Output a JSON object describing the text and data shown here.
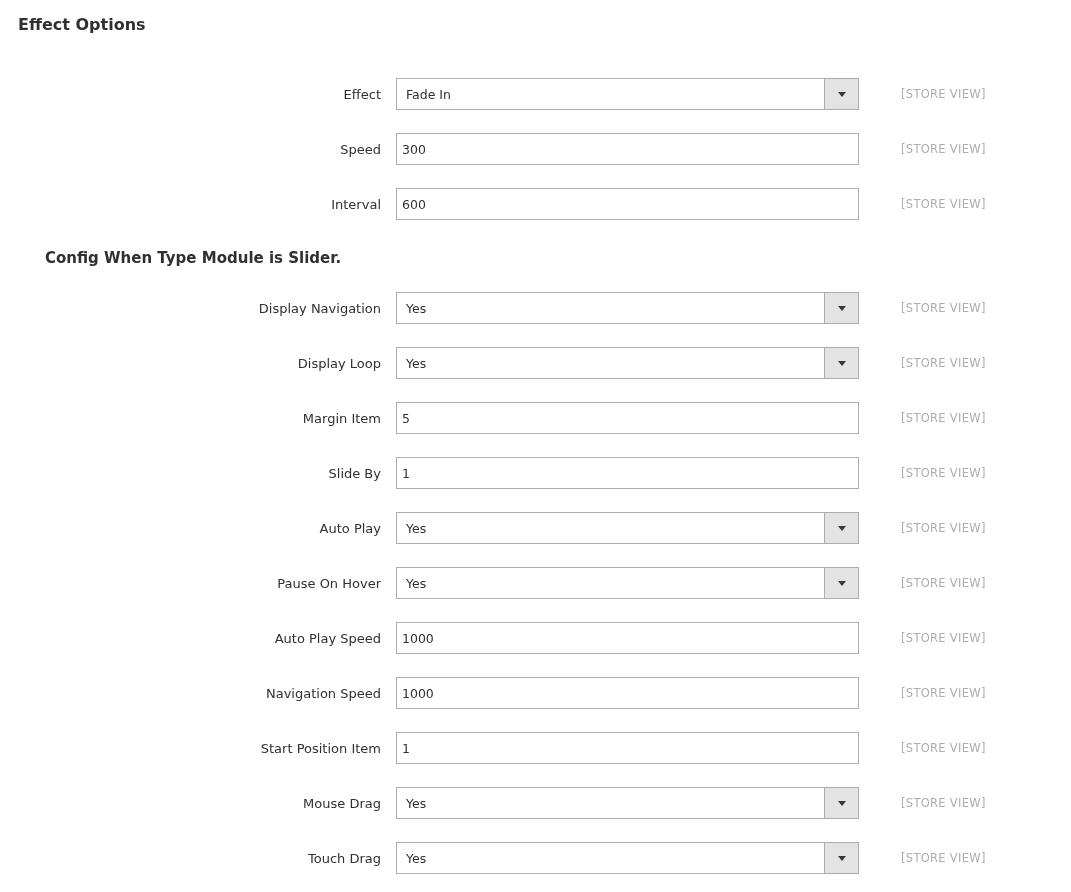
{
  "title": "Effect Options",
  "groups": [
    {
      "fields": [
        {
          "kind": "select",
          "label": "Effect",
          "value": "Fade In",
          "scope": "[STORE VIEW]"
        },
        {
          "kind": "text",
          "label": "Speed",
          "value": "300",
          "scope": "[STORE VIEW]"
        },
        {
          "kind": "text",
          "label": "Interval",
          "value": "600",
          "scope": "[STORE VIEW]"
        }
      ]
    },
    {
      "heading": "Config When Type Module is Slider.",
      "fields": [
        {
          "kind": "select",
          "label": "Display Navigation",
          "value": "Yes",
          "scope": "[STORE VIEW]"
        },
        {
          "kind": "select",
          "label": "Display Loop",
          "value": "Yes",
          "scope": "[STORE VIEW]"
        },
        {
          "kind": "text",
          "label": "Margin Item",
          "value": "5",
          "scope": "[STORE VIEW]"
        },
        {
          "kind": "text",
          "label": "Slide By",
          "value": "1",
          "scope": "[STORE VIEW]"
        },
        {
          "kind": "select",
          "label": "Auto Play",
          "value": "Yes",
          "scope": "[STORE VIEW]"
        },
        {
          "kind": "select",
          "label": "Pause On Hover",
          "value": "Yes",
          "scope": "[STORE VIEW]"
        },
        {
          "kind": "text",
          "label": "Auto Play Speed",
          "value": "1000",
          "scope": "[STORE VIEW]"
        },
        {
          "kind": "text",
          "label": "Navigation Speed",
          "value": "1000",
          "scope": "[STORE VIEW]"
        },
        {
          "kind": "text",
          "label": "Start Position Item",
          "value": "1",
          "scope": "[STORE VIEW]"
        },
        {
          "kind": "select",
          "label": "Mouse Drag",
          "value": "Yes",
          "scope": "[STORE VIEW]"
        },
        {
          "kind": "select",
          "label": "Touch Drag",
          "value": "Yes",
          "scope": "[STORE VIEW]"
        }
      ]
    }
  ]
}
